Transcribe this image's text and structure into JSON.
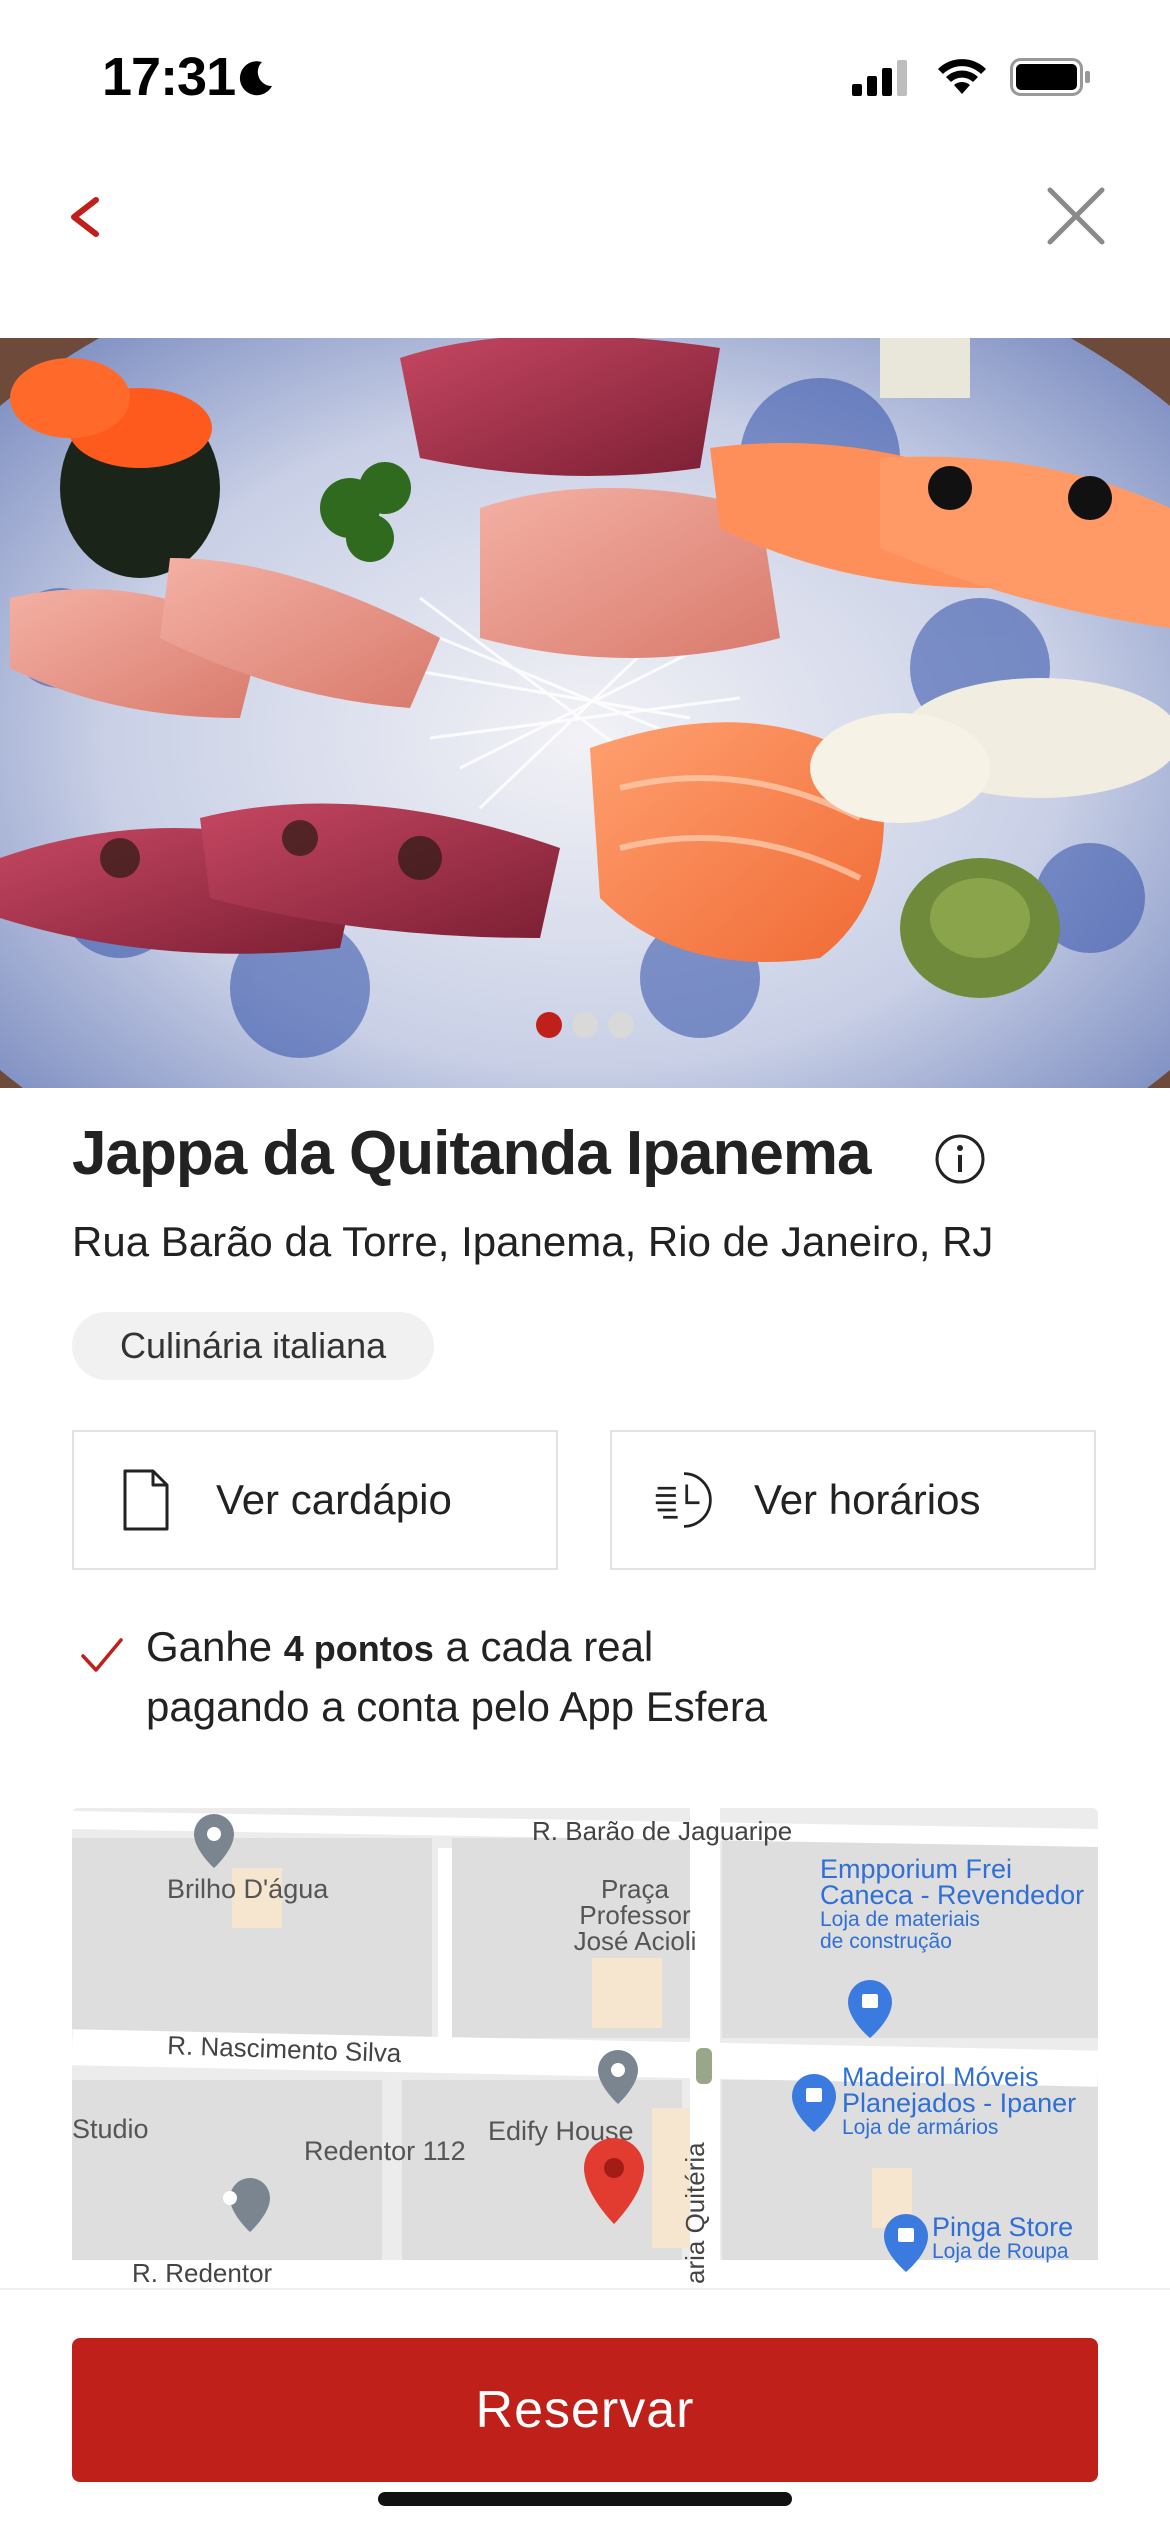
{
  "status_bar": {
    "time": "17:31"
  },
  "restaurant": {
    "name": "Jappa da Quitanda Ipanema",
    "address": "Rua Barão da Torre, Ipanema, Rio de Janeiro, RJ",
    "cuisine_tag": "Culinária italiana"
  },
  "gallery": {
    "image_count": 3,
    "active_index": 0
  },
  "actions": {
    "menu_label": "Ver cardápio",
    "hours_label": "Ver horários"
  },
  "points": {
    "prefix": "Ganhe",
    "bold": "4 pontos",
    "suffix": "a cada real",
    "line2": "pagando a conta pelo App Esfera"
  },
  "map": {
    "streets": [
      "R. Barão de Jaguaripe",
      "R. Nascimento Silva",
      "R. Redentor",
      "aria Quitéria"
    ],
    "places": {
      "brilho": "Brilho D'água",
      "praca_1": "Praça",
      "praca_2": "Professor",
      "praca_3": "José Acioli",
      "empporium_1": "Empporium Frei",
      "empporium_2": "Caneca - Revendedor",
      "empporium_sub_1": "Loja de materiais",
      "empporium_sub_2": "de construção",
      "madeirol_1": "Madeirol Móveis",
      "madeirol_2": "Planejados - Ipaner",
      "madeirol_sub": "Loja de armários",
      "studio": "Studio",
      "redentor": "Redentor 112",
      "edify": "Edify House",
      "pinga": "Pinga Store",
      "pinga_sub": "Loja de Roupa"
    }
  },
  "cta": {
    "reserve_label": "Reservar"
  },
  "colors": {
    "brand_red": "#c0201a"
  }
}
